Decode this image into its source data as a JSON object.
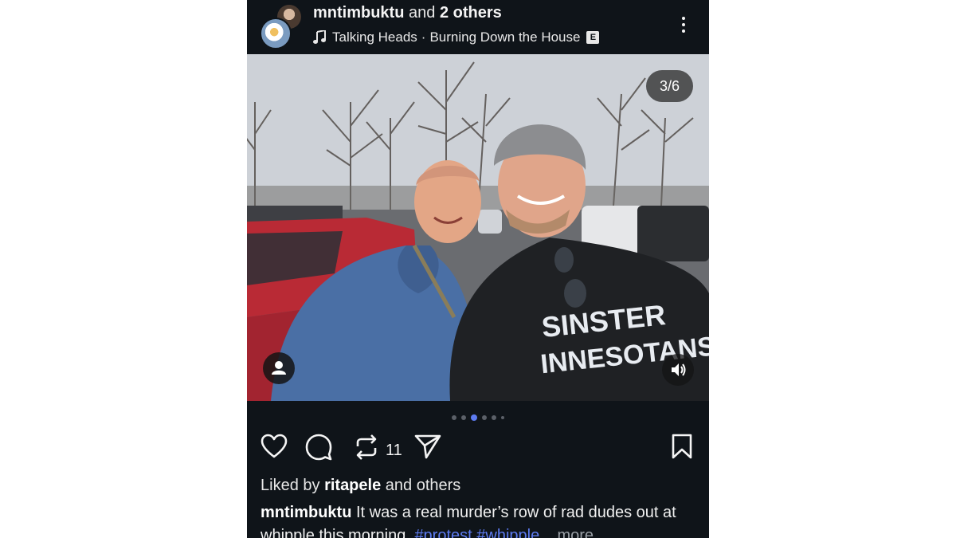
{
  "header": {
    "username": "mntimbuktu",
    "and_text": "and",
    "others_text": "2 others",
    "song_artist": "Talking Heads",
    "song_separator": "·",
    "song_title": "Burning Down the House",
    "explicit_badge": "E"
  },
  "media": {
    "counter": "3/6",
    "shirt_text_line1": "SINSTER",
    "shirt_text_line2": "INNESOTANS",
    "current_index": 3,
    "total": 6
  },
  "actions": {
    "repost_count": "11"
  },
  "likes": {
    "prefix": "Liked by",
    "user": "ritapele",
    "suffix": "and others"
  },
  "caption": {
    "username": "mntimbuktu",
    "text": "It was a real murder’s row of rad dudes out at whipple this morning.",
    "hashtag1": "#protest",
    "hashtag2": "#whipple",
    "ellipsis": "...",
    "more": "more"
  },
  "colors": {
    "background": "#0f1419",
    "accent": "#5d7bf0",
    "text": "#f5f5f5"
  },
  "icons": [
    "music-note-icon",
    "explicit-icon",
    "more-options-icon",
    "user-tag-icon",
    "volume-icon",
    "heart-icon",
    "comment-icon",
    "repost-icon",
    "share-icon",
    "bookmark-icon"
  ]
}
